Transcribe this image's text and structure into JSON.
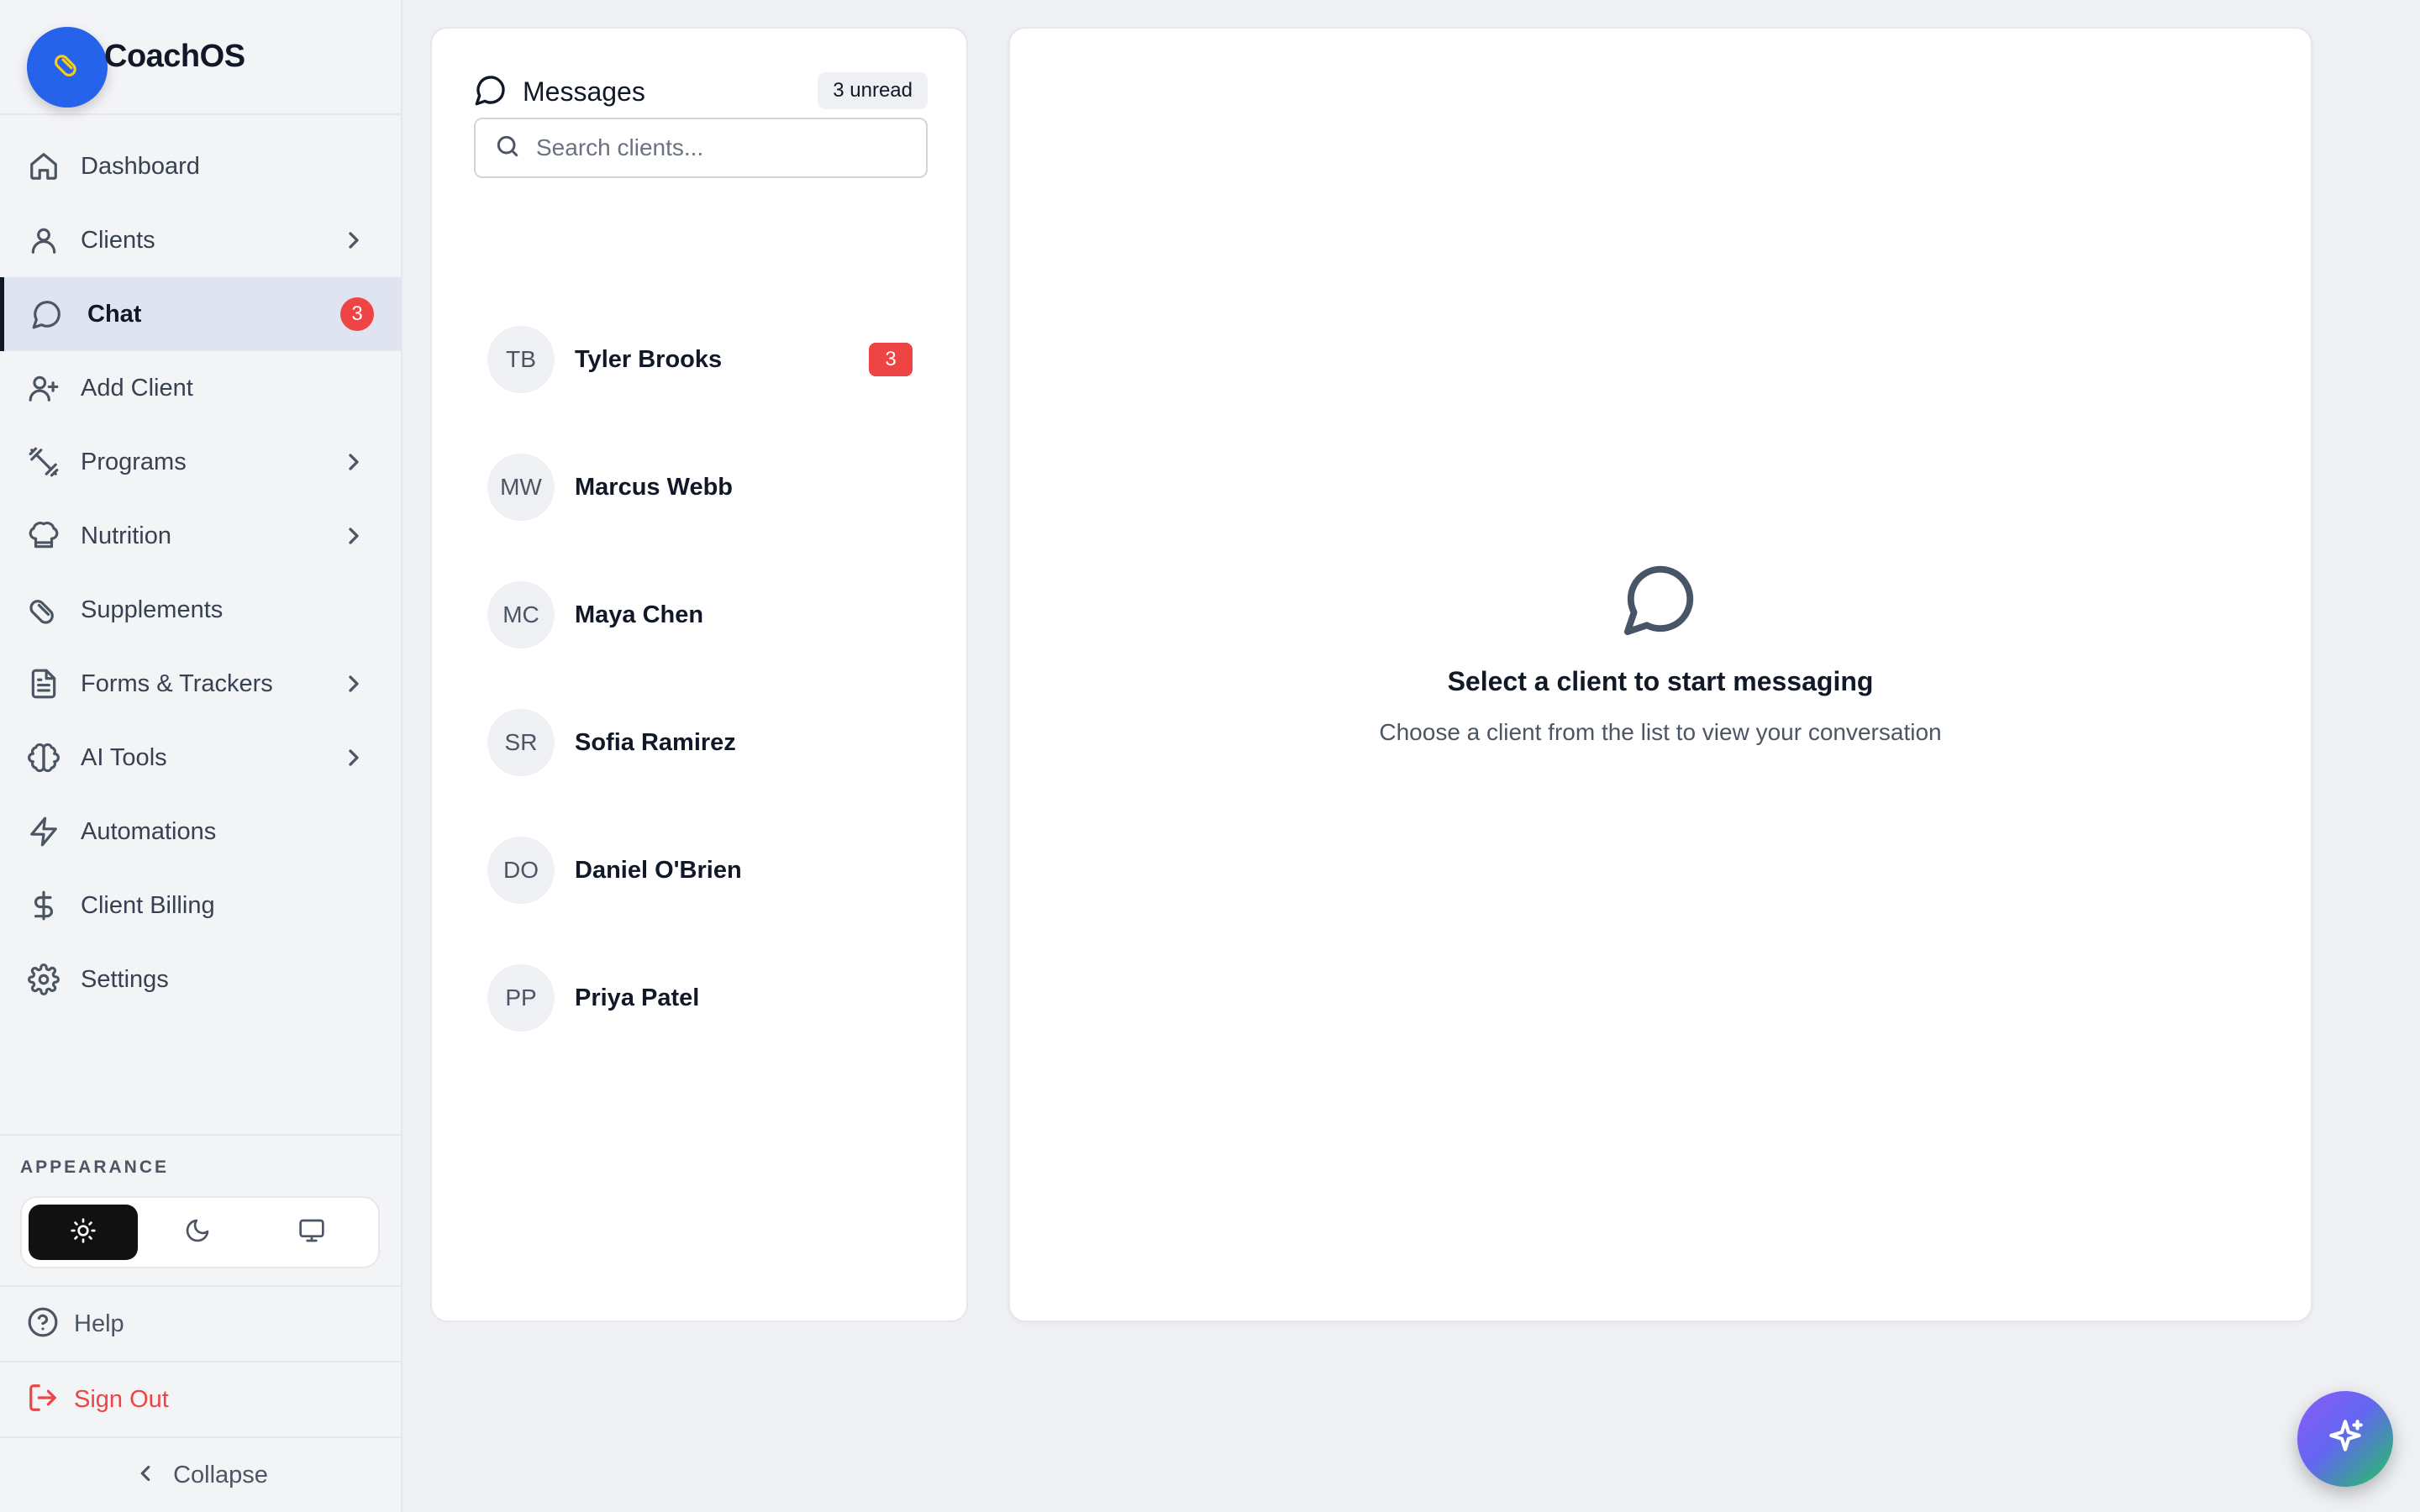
{
  "brand": {
    "name": "CoachOS",
    "logo_icon": "pill-icon"
  },
  "nav": {
    "items": [
      {
        "label": "Dashboard",
        "icon": "home-icon",
        "has_submenu": false,
        "active": false
      },
      {
        "label": "Clients",
        "icon": "user-icon",
        "has_submenu": true,
        "active": false
      },
      {
        "label": "Chat",
        "icon": "chat-icon",
        "has_submenu": false,
        "active": true,
        "badge": "3"
      },
      {
        "label": "Add Client",
        "icon": "user-plus-icon",
        "has_submenu": false,
        "active": false
      },
      {
        "label": "Programs",
        "icon": "dumbbell-icon",
        "has_submenu": true,
        "active": false
      },
      {
        "label": "Nutrition",
        "icon": "chef-hat-icon",
        "has_submenu": true,
        "active": false
      },
      {
        "label": "Supplements",
        "icon": "pill-icon",
        "has_submenu": false,
        "active": false
      },
      {
        "label": "Forms & Trackers",
        "icon": "document-icon",
        "has_submenu": true,
        "active": false
      },
      {
        "label": "AI Tools",
        "icon": "brain-icon",
        "has_submenu": true,
        "active": false
      },
      {
        "label": "Automations",
        "icon": "lightning-icon",
        "has_submenu": false,
        "active": false
      },
      {
        "label": "Client Billing",
        "icon": "dollar-icon",
        "has_submenu": false,
        "active": false
      },
      {
        "label": "Settings",
        "icon": "gear-icon",
        "has_submenu": false,
        "active": false
      }
    ]
  },
  "appearance": {
    "title": "APPEARANCE",
    "options": [
      "sun-icon",
      "moon-icon",
      "monitor-icon"
    ],
    "selected": "light"
  },
  "footer": {
    "help_label": "Help",
    "signout_label": "Sign Out",
    "collapse_label": "Collapse"
  },
  "messages": {
    "title": "Messages",
    "unread_label": "3 unread",
    "search_placeholder": "Search clients...",
    "clients": [
      {
        "initials": "TB",
        "name": "Tyler Brooks",
        "unread": "3"
      },
      {
        "initials": "MW",
        "name": "Marcus Webb",
        "unread": ""
      },
      {
        "initials": "MC",
        "name": "Maya Chen",
        "unread": ""
      },
      {
        "initials": "SR",
        "name": "Sofia Ramirez",
        "unread": ""
      },
      {
        "initials": "DO",
        "name": "Daniel O'Brien",
        "unread": ""
      },
      {
        "initials": "PP",
        "name": "Priya Patel",
        "unread": ""
      }
    ]
  },
  "conversation": {
    "empty_title": "Select a client to start messaging",
    "empty_subtitle": "Choose a client from the list to view your conversation",
    "empty_icon": "chat-icon"
  },
  "fab": {
    "icon": "sparkle-icon"
  },
  "colors": {
    "accent_dark": "#111827",
    "badge_red": "#ef4444",
    "brand_blue": "#2563eb",
    "active_nav_bg": "#dfe4f0"
  }
}
